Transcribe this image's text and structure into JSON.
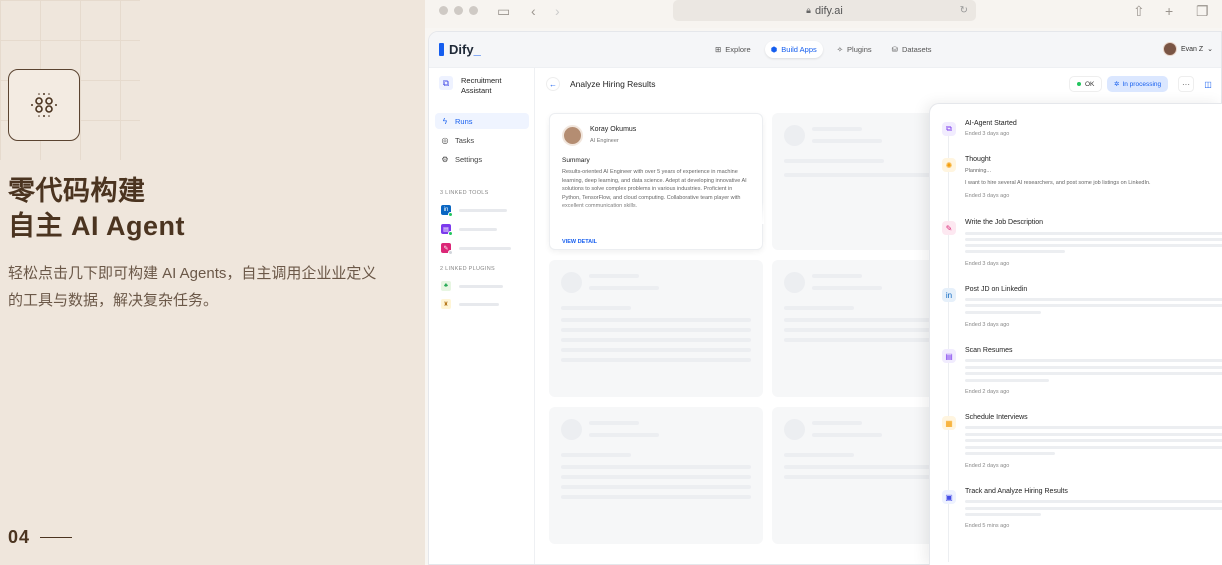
{
  "promo": {
    "headline_line1": "零代码构建",
    "headline_line2": "自主 AI Agent",
    "subtitle": "轻松点击几下即可构建 AI Agents，自主调用企业业定义的工具与数据，解决复杂任务。",
    "page_number": "04"
  },
  "browser": {
    "url": "dify.ai"
  },
  "app": {
    "brand": "Dify",
    "nav": [
      {
        "label": "Explore",
        "icon": "explore-icon",
        "active": false
      },
      {
        "label": "Build Apps",
        "icon": "build-icon",
        "active": true
      },
      {
        "label": "Plugins",
        "icon": "plugin-icon",
        "active": false
      },
      {
        "label": "Datasets",
        "icon": "dataset-icon",
        "active": false
      }
    ],
    "user_name": "Evan Z"
  },
  "sidebar": {
    "assistant_name": "Recruitment Assistant",
    "menu": [
      {
        "label": "Runs",
        "icon": "lightning-icon",
        "active": true
      },
      {
        "label": "Tasks",
        "icon": "task-icon",
        "active": false
      },
      {
        "label": "Settings",
        "icon": "gear-icon",
        "active": false
      }
    ],
    "tools_heading": "3 LINKED TOOLS",
    "plugins_heading": "2 LINKED PLUGINS"
  },
  "main": {
    "title": "Analyze Hiring Results",
    "status_ok": "OK",
    "status_processing": "In processing",
    "candidate": {
      "name": "Koray Okumus",
      "role": "AI Engineer",
      "summary_heading": "Summary",
      "summary_text": "Results-oriented AI Engineer with over 5 years of experience in machine learning, deep learning, and data science. Adept at developing innovative AI solutions to solve complex problems in various industries. Proficient in Python, TensorFlow, and cloud computing. Collaborative team player with excellent communication skills.",
      "view_detail": "VIEW DETAIL"
    }
  },
  "timeline": [
    {
      "name": "AI-Agent Started",
      "time": "Ended 3 days ago",
      "icon": "agent-icon",
      "color": "#7c3aed",
      "bg": "#f1ecfe"
    },
    {
      "name": "Thought",
      "time": "Ended 3 days ago",
      "icon": "thought-icon",
      "color": "#f59e0b",
      "bg": "#fff5e0",
      "desc1": "Planning...",
      "desc2": "I want to hire several AI researchers, and post some job listings on LinkedIn."
    },
    {
      "name": "Write the Job Description",
      "time": "Ended 3 days ago",
      "icon": "pen-icon",
      "color": "#db2777",
      "bg": "#fde8f1"
    },
    {
      "name": "Post JD on Linkedin",
      "time": "Ended 3 days ago",
      "icon": "linkedin-icon",
      "color": "#0a66c2",
      "bg": "#e6f0fa"
    },
    {
      "name": "Scan Resumes",
      "time": "Ended 2 days ago",
      "icon": "document-icon",
      "color": "#7c3aed",
      "bg": "#f1ecfe"
    },
    {
      "name": "Schedule Interviews",
      "time": "Ended 2 days ago",
      "icon": "calendar-icon",
      "color": "#f59e0b",
      "bg": "#fff5e0"
    },
    {
      "name": "Track and Analyze Hiring Results",
      "time": "Ended 5 mins ago",
      "icon": "chart-icon",
      "color": "#444ce7",
      "bg": "#eef2ff"
    }
  ]
}
